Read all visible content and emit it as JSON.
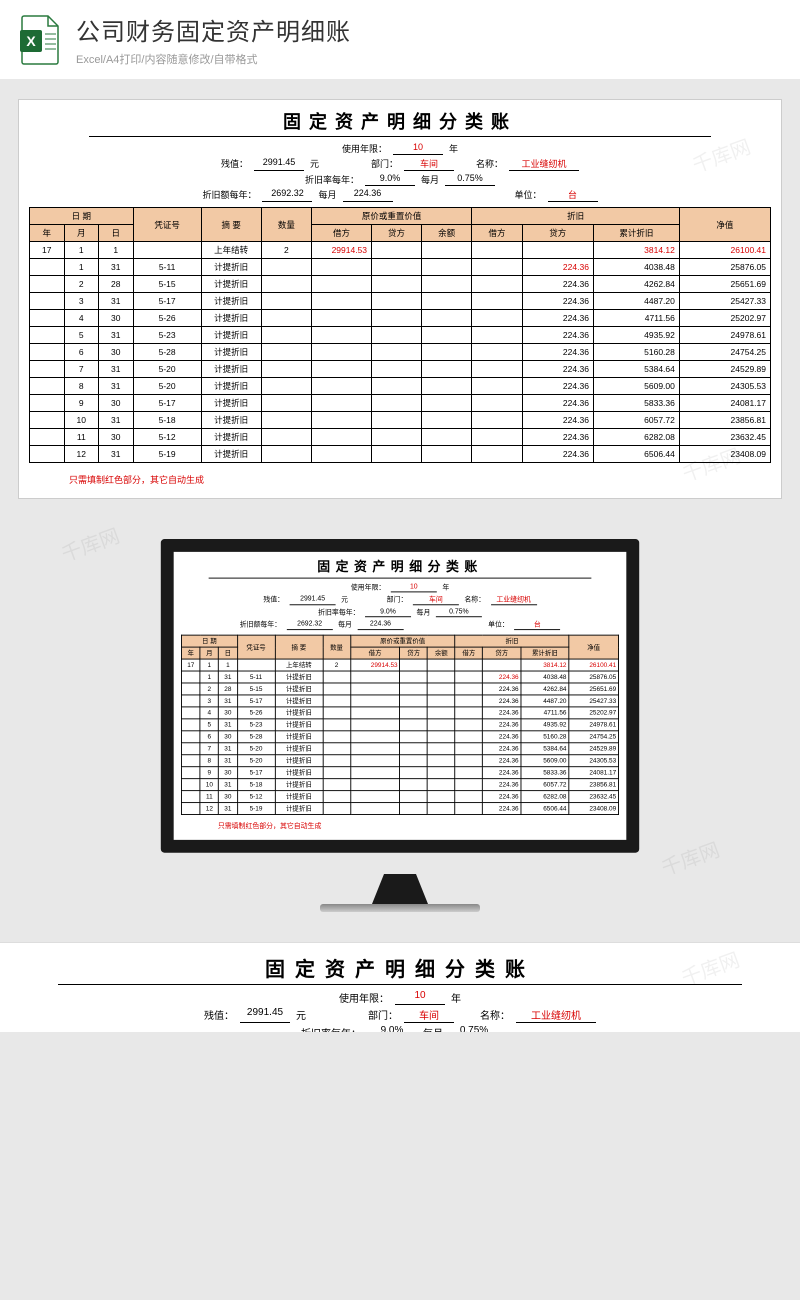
{
  "banner": {
    "title": "公司财务固定资产明细账",
    "subtitle": "Excel/A4打印/内容随意修改/自带格式"
  },
  "sheet": {
    "title": "固定资产明细分类账",
    "meta": {
      "use_years_label": "使用年限：",
      "use_years": "10",
      "year_unit": "年",
      "residual_label": "残值：",
      "residual": "2991.45",
      "yuan": "元",
      "dep_rate_y_label": "折旧率每年：",
      "dep_rate_y": "9.0%",
      "month_label": "每月",
      "dep_rate_m": "0.75%",
      "dep_amt_y_label": "折旧额每年：",
      "dep_amt_y": "2692.32",
      "dep_amt_m": "224.36",
      "dept_label": "部门：",
      "dept": "车间",
      "name_label": "名称：",
      "name": "工业缝纫机",
      "unit_label": "单位：",
      "unit": "台"
    },
    "headers": {
      "date": "日 期",
      "year": "年",
      "month": "月",
      "day": "日",
      "voucher": "凭证号",
      "summary": "摘 要",
      "qty": "数量",
      "orig_group": "原价或重置价值",
      "debit": "借方",
      "credit": "贷方",
      "balance": "余额",
      "dep_group": "折旧",
      "acc_dep": "累计折旧",
      "net": "净值"
    },
    "rows": [
      {
        "y": "17",
        "m": "1",
        "d": "1",
        "v": "",
        "s": "上年结转",
        "q": "2",
        "od": "29914.53",
        "oc": "",
        "ob": "",
        "dd": "",
        "dc": "",
        "ad": "3814.12",
        "net": "26100.41"
      },
      {
        "y": "",
        "m": "1",
        "d": "31",
        "v": "5-11",
        "s": "计提折旧",
        "q": "",
        "od": "",
        "oc": "",
        "ob": "",
        "dd": "",
        "dc": "224.36",
        "ad": "4038.48",
        "net": "25876.05"
      },
      {
        "y": "",
        "m": "2",
        "d": "28",
        "v": "5-15",
        "s": "计提折旧",
        "q": "",
        "od": "",
        "oc": "",
        "ob": "",
        "dd": "",
        "dc": "224.36",
        "ad": "4262.84",
        "net": "25651.69"
      },
      {
        "y": "",
        "m": "3",
        "d": "31",
        "v": "5-17",
        "s": "计提折旧",
        "q": "",
        "od": "",
        "oc": "",
        "ob": "",
        "dd": "",
        "dc": "224.36",
        "ad": "4487.20",
        "net": "25427.33"
      },
      {
        "y": "",
        "m": "4",
        "d": "30",
        "v": "5-26",
        "s": "计提折旧",
        "q": "",
        "od": "",
        "oc": "",
        "ob": "",
        "dd": "",
        "dc": "224.36",
        "ad": "4711.56",
        "net": "25202.97"
      },
      {
        "y": "",
        "m": "5",
        "d": "31",
        "v": "5-23",
        "s": "计提折旧",
        "q": "",
        "od": "",
        "oc": "",
        "ob": "",
        "dd": "",
        "dc": "224.36",
        "ad": "4935.92",
        "net": "24978.61"
      },
      {
        "y": "",
        "m": "6",
        "d": "30",
        "v": "5-28",
        "s": "计提折旧",
        "q": "",
        "od": "",
        "oc": "",
        "ob": "",
        "dd": "",
        "dc": "224.36",
        "ad": "5160.28",
        "net": "24754.25"
      },
      {
        "y": "",
        "m": "7",
        "d": "31",
        "v": "5-20",
        "s": "计提折旧",
        "q": "",
        "od": "",
        "oc": "",
        "ob": "",
        "dd": "",
        "dc": "224.36",
        "ad": "5384.64",
        "net": "24529.89"
      },
      {
        "y": "",
        "m": "8",
        "d": "31",
        "v": "5-20",
        "s": "计提折旧",
        "q": "",
        "od": "",
        "oc": "",
        "ob": "",
        "dd": "",
        "dc": "224.36",
        "ad": "5609.00",
        "net": "24305.53"
      },
      {
        "y": "",
        "m": "9",
        "d": "30",
        "v": "5-17",
        "s": "计提折旧",
        "q": "",
        "od": "",
        "oc": "",
        "ob": "",
        "dd": "",
        "dc": "224.36",
        "ad": "5833.36",
        "net": "24081.17"
      },
      {
        "y": "",
        "m": "10",
        "d": "31",
        "v": "5-18",
        "s": "计提折旧",
        "q": "",
        "od": "",
        "oc": "",
        "ob": "",
        "dd": "",
        "dc": "224.36",
        "ad": "6057.72",
        "net": "23856.81"
      },
      {
        "y": "",
        "m": "11",
        "d": "30",
        "v": "5-12",
        "s": "计提折旧",
        "q": "",
        "od": "",
        "oc": "",
        "ob": "",
        "dd": "",
        "dc": "224.36",
        "ad": "6282.08",
        "net": "23632.45"
      },
      {
        "y": "",
        "m": "12",
        "d": "31",
        "v": "5-19",
        "s": "计提折旧",
        "q": "",
        "od": "",
        "oc": "",
        "ob": "",
        "dd": "",
        "dc": "224.36",
        "ad": "6506.44",
        "net": "23408.09"
      }
    ],
    "note": "只需填制红色部分，其它自动生成"
  },
  "watermark": "千库网"
}
